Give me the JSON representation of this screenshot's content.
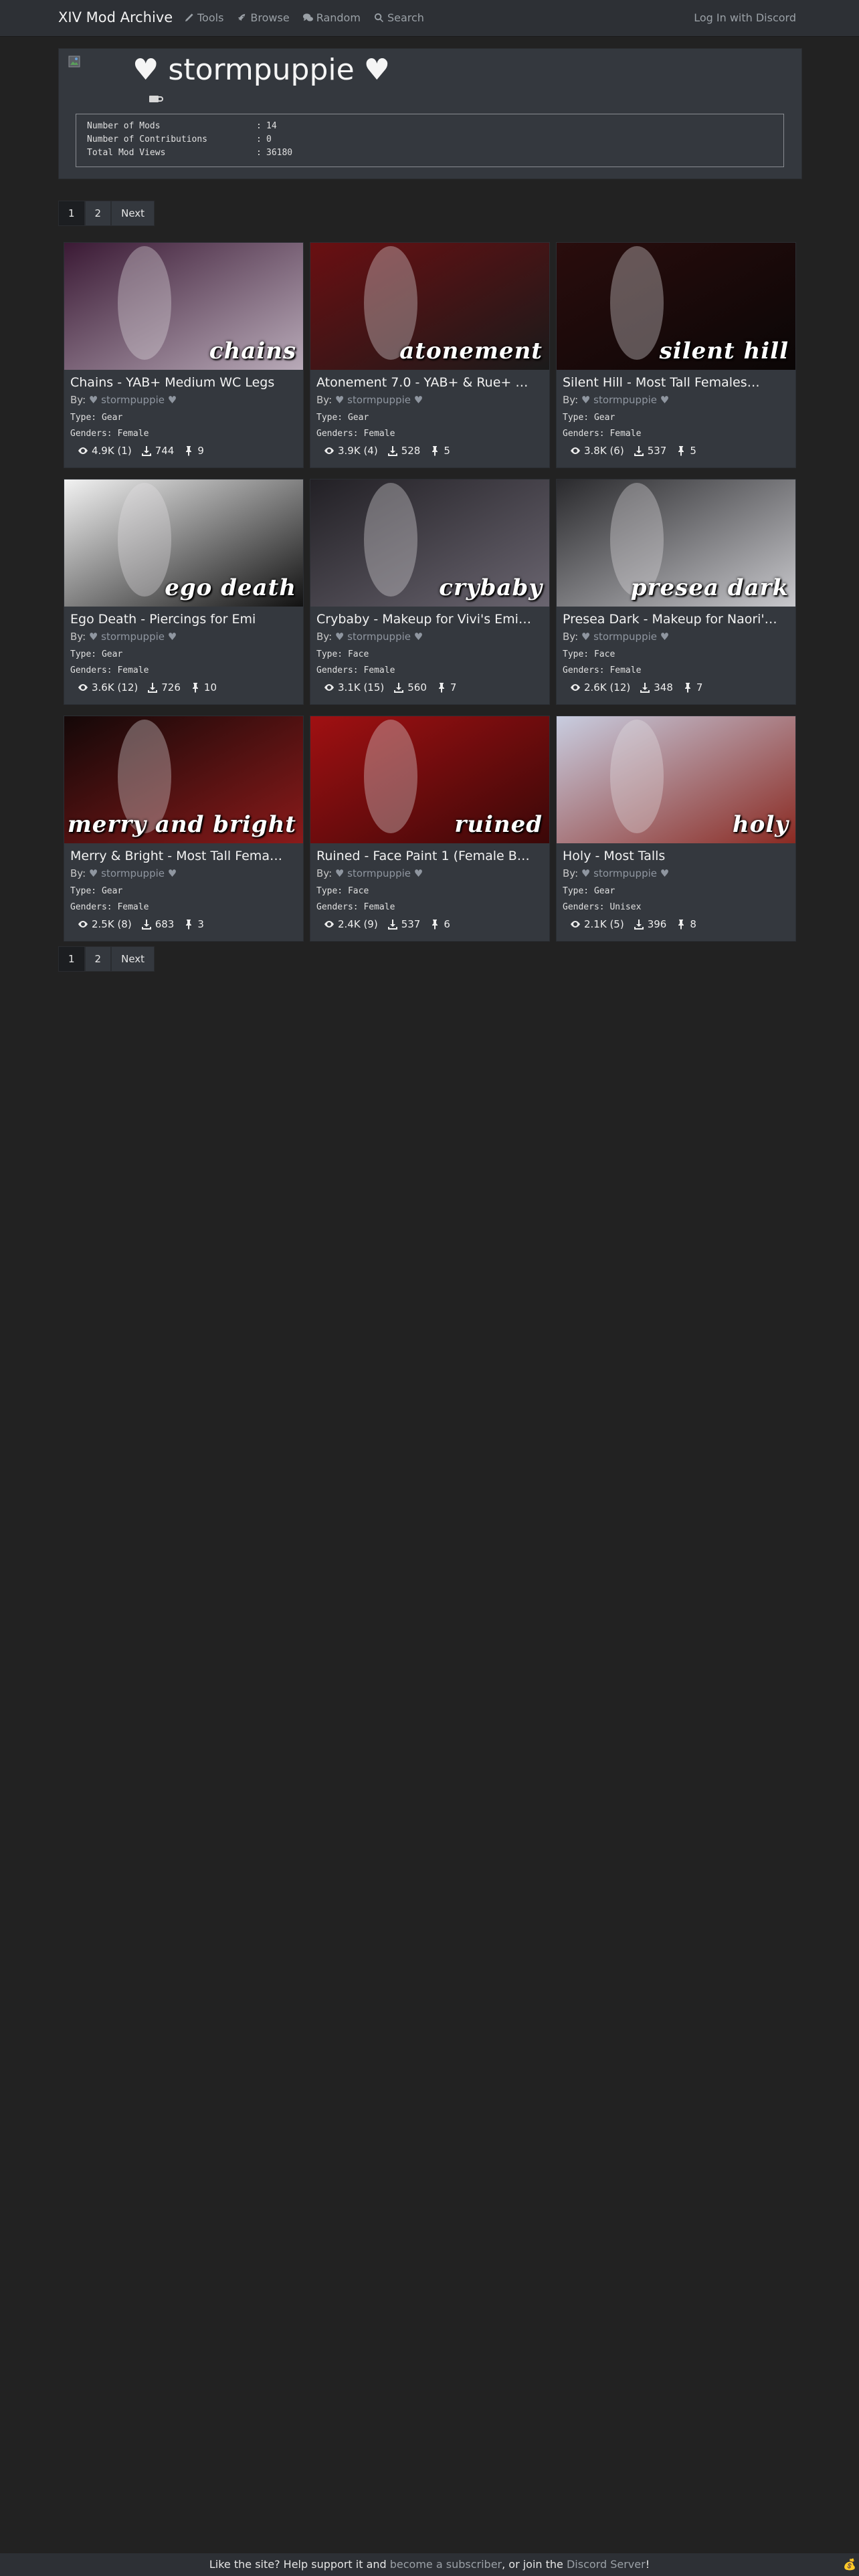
{
  "nav": {
    "brand": "XIV Mod Archive",
    "links": [
      {
        "label": "Tools",
        "icon": "pencil-icon"
      },
      {
        "label": "Browse",
        "icon": "rocket-icon"
      },
      {
        "label": "Random",
        "icon": "comments-icon"
      },
      {
        "label": "Search",
        "icon": "search-icon"
      }
    ],
    "login": "Log In with Discord"
  },
  "profile": {
    "name": "♥ stormpuppie ♥",
    "stats": [
      {
        "label": "Number of Mods",
        "sep": ":",
        "value": "14"
      },
      {
        "label": "Number of Contributions",
        "sep": ":",
        "value": "0"
      },
      {
        "label": "Total Mod Views",
        "sep": ":",
        "value": "36180"
      }
    ]
  },
  "pagination": {
    "pages": [
      "1",
      "2"
    ],
    "next": "Next",
    "active": "1"
  },
  "mods": [
    {
      "title": "Chains - YAB+ Medium WC Legs",
      "by_label": "By:",
      "author": "♥ stormpuppie ♥",
      "type": "Type: Gear",
      "genders": "Genders: Female",
      "views": "4.9K (1)",
      "downloads": "744",
      "pins": "9",
      "thumb_text": "chains",
      "colors": [
        "#3b1a35",
        "#b8aab8"
      ]
    },
    {
      "title": "Atonement 7.0 - YAB+ & Rue+ …",
      "by_label": "By:",
      "author": "♥ stormpuppie ♥",
      "type": "Type: Gear",
      "genders": "Genders: Female",
      "views": "3.9K (4)",
      "downloads": "528",
      "pins": "5",
      "thumb_text": "atonement",
      "colors": [
        "#6a0f12",
        "#1a1a1a"
      ]
    },
    {
      "title": "Silent Hill - Most Tall Females…",
      "by_label": "By:",
      "author": "♥ stormpuppie ♥",
      "type": "Type: Gear",
      "genders": "Genders: Female",
      "views": "3.8K (6)",
      "downloads": "537",
      "pins": "5",
      "thumb_text": "silent hill",
      "colors": [
        "#2a0d0d",
        "#0a0606"
      ]
    },
    {
      "title": "Ego Death - Piercings for Emi",
      "by_label": "By:",
      "author": "♥ stormpuppie ♥",
      "type": "Type: Gear",
      "genders": "Genders: Female",
      "views": "3.6K (12)",
      "downloads": "726",
      "pins": "10",
      "thumb_text": "ego death",
      "colors": [
        "#f2f2f2",
        "#111111"
      ]
    },
    {
      "title": "Crybaby - Makeup for Vivi's Emi…",
      "by_label": "By:",
      "author": "♥ stormpuppie ♥",
      "type": "Type: Face",
      "genders": "Genders: Female",
      "views": "3.1K (15)",
      "downloads": "560",
      "pins": "7",
      "thumb_text": "crybaby",
      "colors": [
        "#222025",
        "#6a6570"
      ]
    },
    {
      "title": "Presea Dark - Makeup for Naori'…",
      "by_label": "By:",
      "author": "♥ stormpuppie ♥",
      "type": "Type: Face",
      "genders": "Genders: Female",
      "views": "2.6K (12)",
      "downloads": "348",
      "pins": "7",
      "thumb_text": "presea dark",
      "colors": [
        "#2a2a2d",
        "#c8c8cc"
      ]
    },
    {
      "title": "Merry & Bright - Most Tall Fema…",
      "by_label": "By:",
      "author": "♥ stormpuppie ♥",
      "type": "Type: Gear",
      "genders": "Genders: Female",
      "views": "2.5K (8)",
      "downloads": "683",
      "pins": "3",
      "thumb_text": "merry and bright",
      "colors": [
        "#140808",
        "#8a1a1a"
      ]
    },
    {
      "title": "Ruined - Face Paint 1 (Female B…",
      "by_label": "By:",
      "author": "♥ stormpuppie ♥",
      "type": "Type: Face",
      "genders": "Genders: Female",
      "views": "2.4K (9)",
      "downloads": "537",
      "pins": "6",
      "thumb_text": "ruined",
      "colors": [
        "#a01012",
        "#3a0808"
      ]
    },
    {
      "title": "Holy - Most Talls",
      "by_label": "By:",
      "author": "♥ stormpuppie ♥",
      "type": "Type: Gear",
      "genders": "Genders: Unisex",
      "views": "2.1K (5)",
      "downloads": "396",
      "pins": "8",
      "thumb_text": "holy",
      "colors": [
        "#c8cde0",
        "#8a2a22"
      ]
    }
  ],
  "footer": {
    "text1": "Like the site? Help support it and ",
    "link1": "become a subscriber",
    "text2": ", or join the ",
    "link2": "Discord Server",
    "text3": "!",
    "emoji": "💰"
  }
}
